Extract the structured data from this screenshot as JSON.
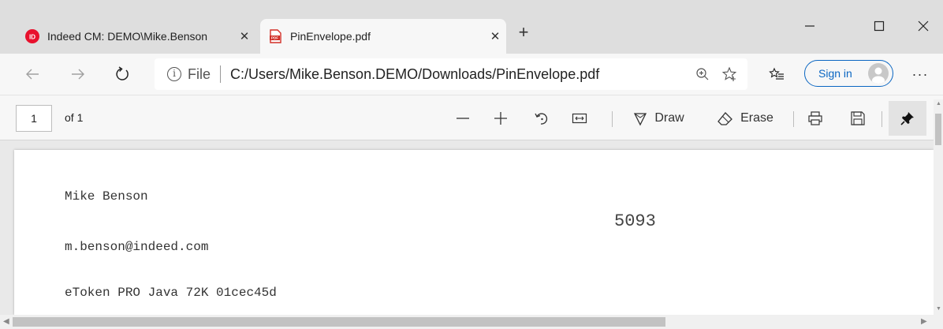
{
  "tabs": [
    {
      "title": "Indeed CM: DEMO\\Mike.Benson",
      "close": "✕",
      "favicon": "indeed-logo-icon"
    },
    {
      "title": "PinEnvelope.pdf",
      "close": "✕",
      "favicon": "pdf-file-icon"
    }
  ],
  "new_tab": "+",
  "addressbar": {
    "info": "i",
    "scheme": "File",
    "url": "C:/Users/Mike.Benson.DEMO/Downloads/PinEnvelope.pdf",
    "signin_label": "Sign in",
    "more": "···"
  },
  "pdf_toolbar": {
    "page_number": "1",
    "page_of": "of 1",
    "draw_label": "Draw",
    "erase_label": "Erase"
  },
  "document": {
    "name": "Mike Benson",
    "email": "m.benson@indeed.com",
    "device": "eToken PRO Java 72K 01cec45d",
    "pin": "5093"
  },
  "colors": {
    "accent": "#0a66c2",
    "indeed_red": "#e8112d",
    "pdf_red": "#d22f27"
  }
}
